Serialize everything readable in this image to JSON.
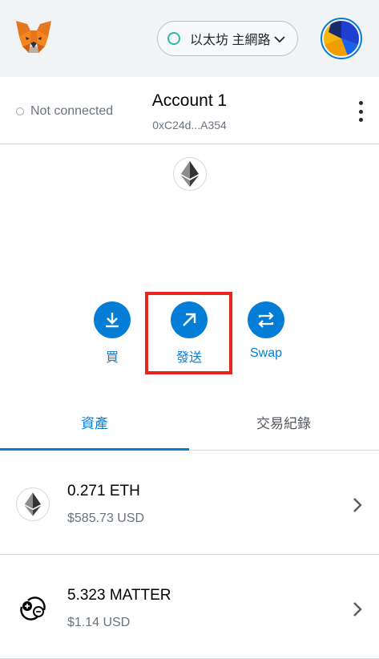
{
  "header": {
    "network_label": "以太坊 主網路"
  },
  "account": {
    "connection_status": "Not connected",
    "name": "Account 1",
    "address": "0xC24d...A354"
  },
  "actions": [
    {
      "label": "買",
      "icon": "download-icon"
    },
    {
      "label": "發送",
      "icon": "arrow-up-right-icon"
    },
    {
      "label": "Swap",
      "icon": "swap-icon"
    }
  ],
  "tabs": [
    {
      "label": "資產",
      "active": true
    },
    {
      "label": "交易紀錄",
      "active": false
    }
  ],
  "assets": [
    {
      "amount": "0.271 ETH",
      "fiat": "$585.73 USD",
      "icon": "ethereum-icon"
    },
    {
      "amount": "5.323 MATTER",
      "fiat": "$1.14 USD",
      "icon": "matter-token-icon"
    }
  ],
  "colors": {
    "accent": "#037dd6",
    "highlight": "#e8261b",
    "network_dot": "#29b6af"
  }
}
